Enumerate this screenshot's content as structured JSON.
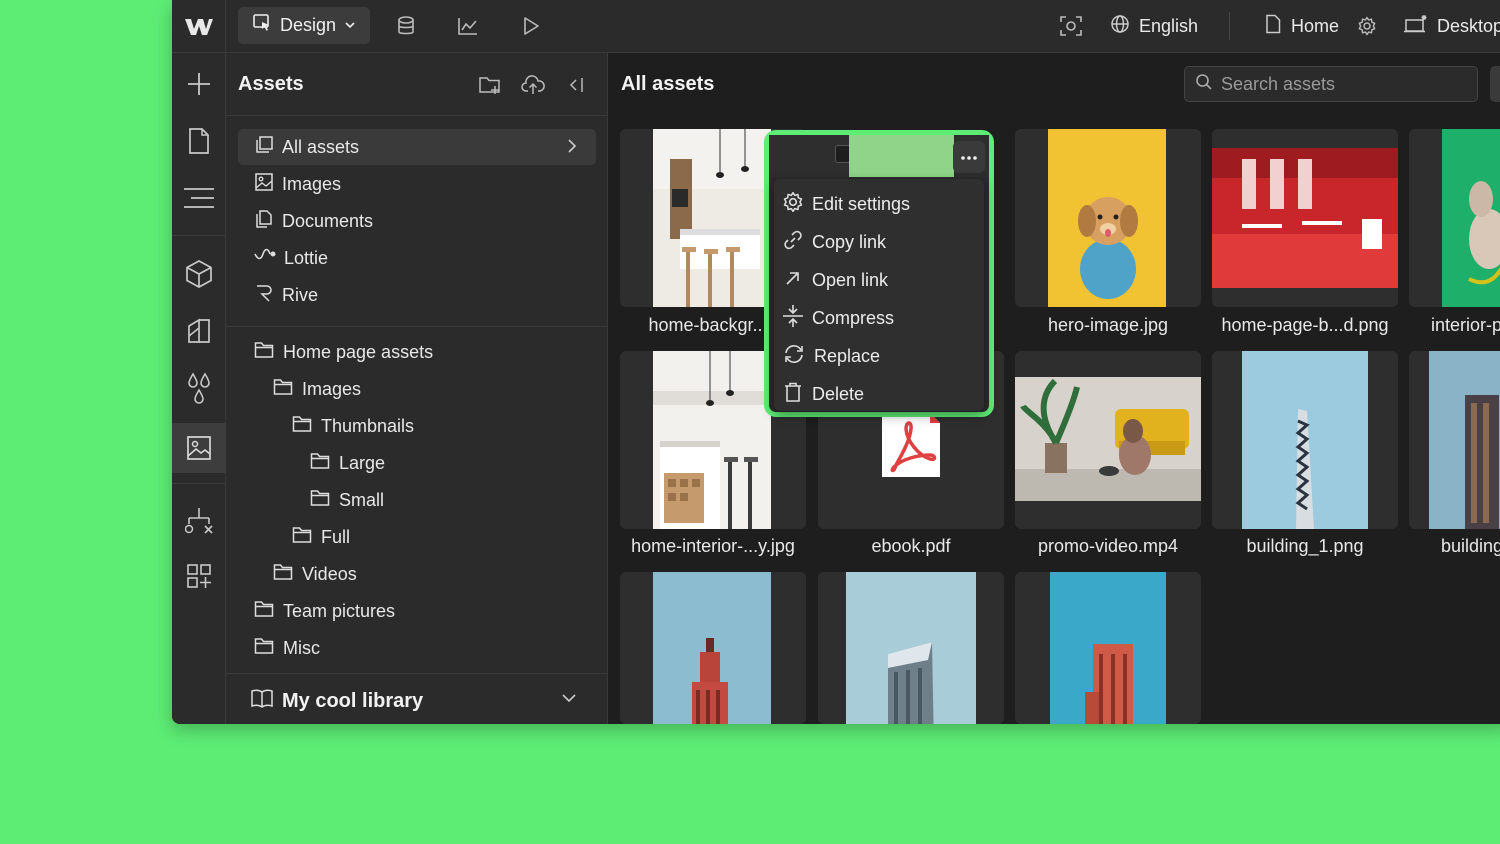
{
  "topbar": {
    "mode_label": "Design",
    "language_label": "English",
    "page_label": "Home",
    "breakpoint_label": "Desktop"
  },
  "panel": {
    "title": "Assets",
    "nav": [
      {
        "label": "All assets"
      },
      {
        "label": "Images"
      },
      {
        "label": "Documents"
      },
      {
        "label": "Lottie"
      },
      {
        "label": "Rive"
      }
    ],
    "folders": [
      {
        "label": "Home page assets"
      },
      {
        "label": "Images"
      },
      {
        "label": "Thumbnails"
      },
      {
        "label": "Large"
      },
      {
        "label": "Small"
      },
      {
        "label": "Full"
      },
      {
        "label": "Videos"
      },
      {
        "label": "Team pictures"
      },
      {
        "label": "Misc"
      }
    ],
    "library_label": "My cool library"
  },
  "main": {
    "title": "All assets",
    "search_placeholder": "Search assets",
    "assets": [
      {
        "name": "home-backgr...e"
      },
      {
        "name": "hero-image.jpg"
      },
      {
        "name": "home-page-b...d.png"
      },
      {
        "name": "interior-p"
      },
      {
        "name": "home-interior-...y.jpg"
      },
      {
        "name": "ebook.pdf"
      },
      {
        "name": "promo-video.mp4"
      },
      {
        "name": "building_1.png"
      },
      {
        "name": "building"
      }
    ]
  },
  "context_menu": {
    "items": [
      {
        "label": "Edit settings",
        "icon": "gear-icon"
      },
      {
        "label": "Copy link",
        "icon": "link-icon"
      },
      {
        "label": "Open link",
        "icon": "arrow-up-right-icon"
      },
      {
        "label": "Compress",
        "icon": "compress-icon"
      },
      {
        "label": "Replace",
        "icon": "replace-icon"
      },
      {
        "label": "Delete",
        "icon": "trash-icon"
      }
    ]
  },
  "colors": {
    "accent_green": "#5ded75",
    "panel_bg": "#2b2b2b",
    "canvas_bg": "#1e1e1e"
  }
}
